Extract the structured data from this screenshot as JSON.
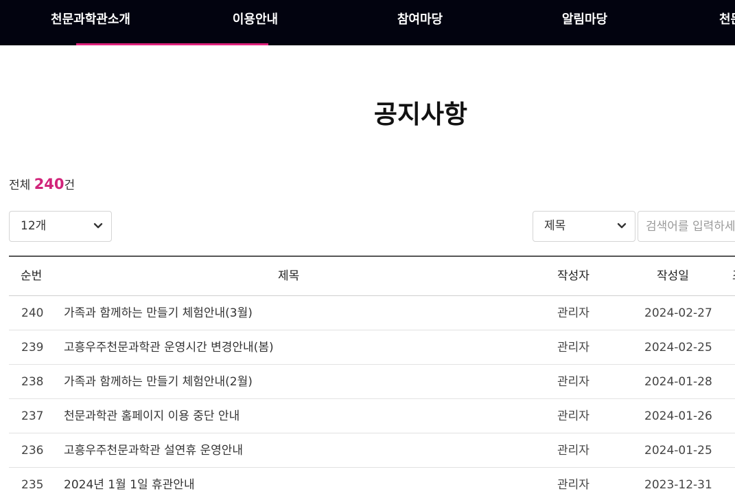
{
  "nav": {
    "items": [
      {
        "label": "천문과학관소개"
      },
      {
        "label": "이용안내"
      },
      {
        "label": "참여마당"
      },
      {
        "label": "알림마당"
      },
      {
        "label": "천문"
      }
    ],
    "active_index": 1,
    "accent_color": "#e0237d",
    "background": "#02030f"
  },
  "page": {
    "title": "공지사항"
  },
  "summary": {
    "prefix": "전체",
    "count": "240",
    "suffix": "건",
    "count_color": "#d1247a"
  },
  "filters": {
    "per_page_value": "12개",
    "search_field_value": "제목",
    "search_placeholder": "검색어를 입력하세요",
    "chevron_icon": "chevron-down-icon"
  },
  "table": {
    "headers": {
      "number": "순번",
      "title": "제목",
      "author": "작성자",
      "date": "작성일",
      "views": "조회"
    },
    "rows": [
      {
        "number": "240",
        "title": "가족과 함께하는 만들기 체험안내(3월)",
        "author": "관리자",
        "date": "2024-02-27"
      },
      {
        "number": "239",
        "title": "고흥우주천문과학관 운영시간 변경안내(봄)",
        "author": "관리자",
        "date": "2024-02-25"
      },
      {
        "number": "238",
        "title": "가족과 함께하는 만들기 체험안내(2월)",
        "author": "관리자",
        "date": "2024-01-28"
      },
      {
        "number": "237",
        "title": "천문과학관 홈페이지 이용 중단 안내",
        "author": "관리자",
        "date": "2024-01-26"
      },
      {
        "number": "236",
        "title": "고흥우주천문과학관 설연휴 운영안내",
        "author": "관리자",
        "date": "2024-01-25"
      },
      {
        "number": "235",
        "title": "2024년 1월 1일 휴관안내",
        "author": "관리자",
        "date": "2023-12-31"
      }
    ]
  }
}
